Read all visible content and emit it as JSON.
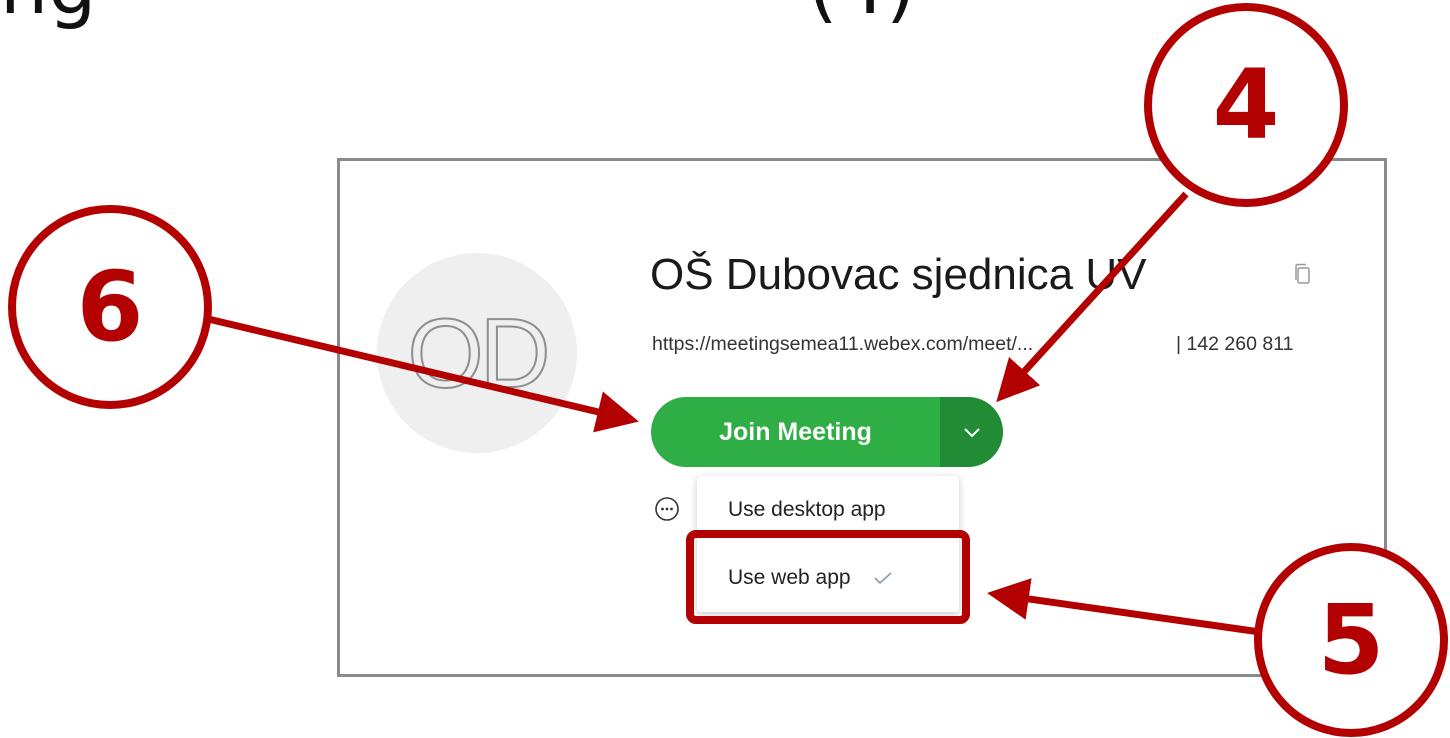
{
  "heading": {
    "left_fragment": "ng",
    "right_fragment": "(4)"
  },
  "meeting": {
    "avatar_initials": "OD",
    "title": "OŠ Dubovac sjednica UV",
    "link": "https://meetingsemea11.webex.com/meet/...",
    "number": "| 142 260 811"
  },
  "join": {
    "label": "Join Meeting"
  },
  "dropdown": {
    "items": [
      {
        "label": "Use desktop app",
        "selected": false
      },
      {
        "label": "Use web app",
        "selected": true
      }
    ]
  },
  "annotations": {
    "step_join": "6",
    "step_dropdown": "4",
    "step_web_app": "5",
    "color": "#b30000"
  },
  "colors": {
    "join_green": "#2fae45",
    "dropdown_green": "#228b35"
  },
  "icons": {
    "copy": "copy-icon",
    "chevron": "chevron-down-icon",
    "more": "more-options-icon",
    "check": "checkmark-icon"
  }
}
